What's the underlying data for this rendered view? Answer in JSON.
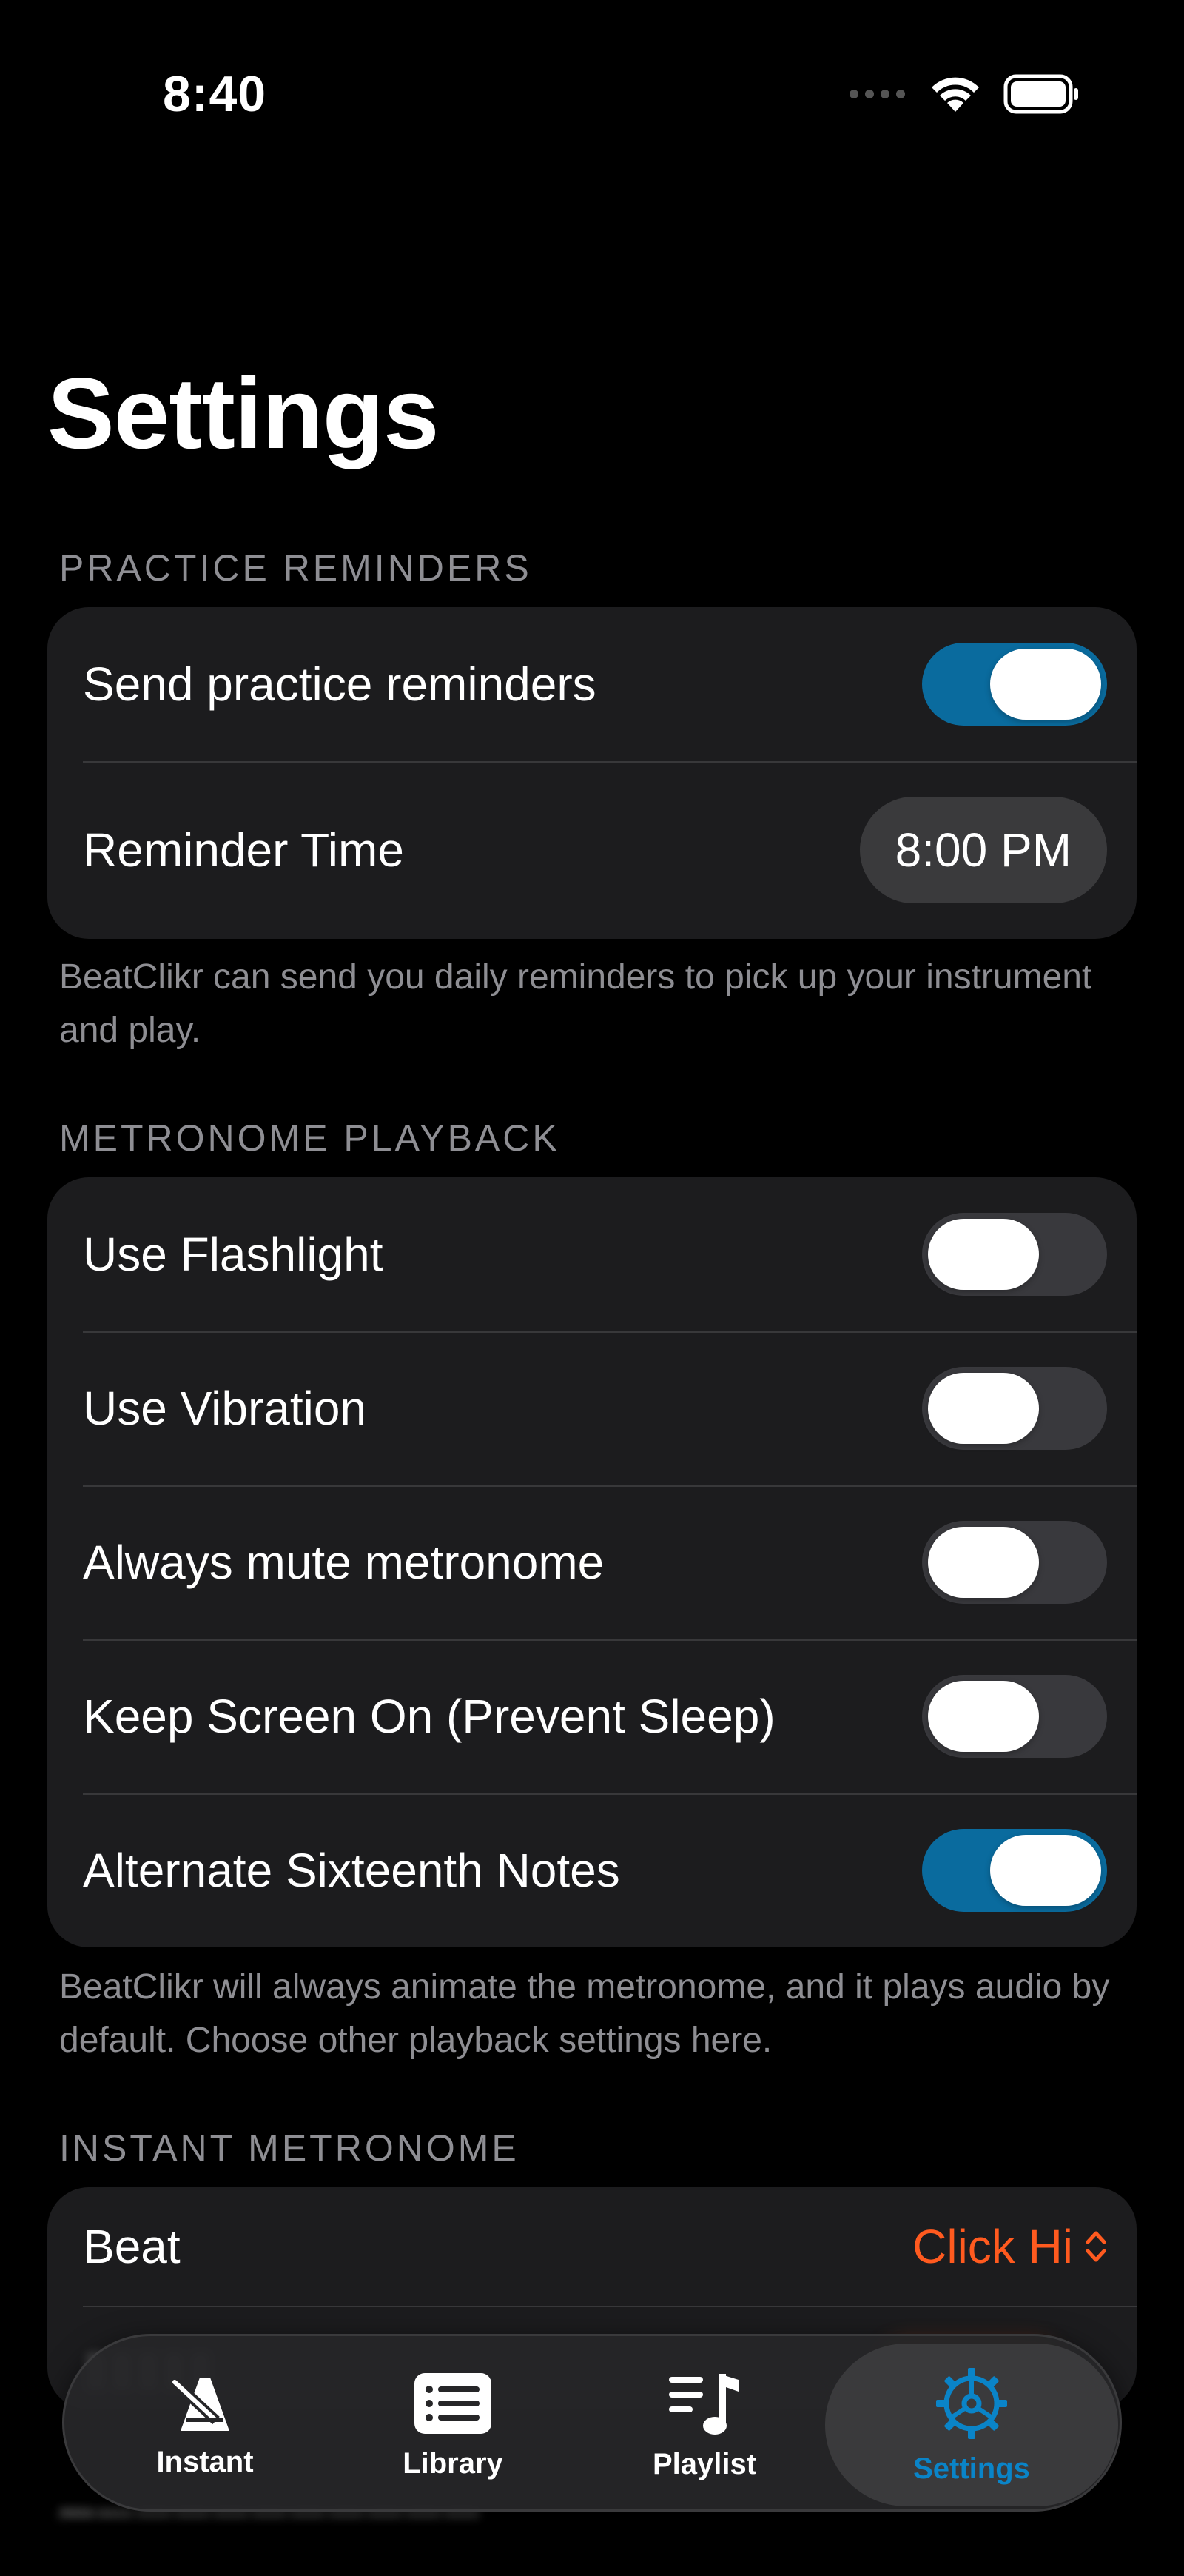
{
  "status_bar": {
    "time": "8:40"
  },
  "page_title": "Settings",
  "sections": {
    "reminders": {
      "header": "PRACTICE REMINDERS",
      "send_label": "Send practice reminders",
      "send_on": true,
      "time_label": "Reminder Time",
      "time_value": "8:00 PM",
      "footer": "BeatClikr can send you daily reminders to pick up your instrument and play."
    },
    "playback": {
      "header": "METRONOME PLAYBACK",
      "rows": [
        {
          "label": "Use Flashlight",
          "on": false
        },
        {
          "label": "Use Vibration",
          "on": false
        },
        {
          "label": "Always mute metronome",
          "on": false
        },
        {
          "label": "Keep Screen On (Prevent Sleep)",
          "on": false
        },
        {
          "label": "Alternate Sixteenth Notes",
          "on": true
        }
      ],
      "footer": "BeatClikr will always animate the metronome, and it plays audio by default. Choose other playback settings here."
    },
    "instant": {
      "header": "INSTANT METRONOME",
      "beat_label": "Beat",
      "beat_value": "Click Hi"
    }
  },
  "tab_bar": {
    "tabs": [
      {
        "label": "Instant",
        "icon": "metronome-icon"
      },
      {
        "label": "Library",
        "icon": "list-icon"
      },
      {
        "label": "Playlist",
        "icon": "music-list-icon"
      },
      {
        "label": "Settings",
        "icon": "gear-icon",
        "selected": true
      }
    ]
  },
  "colors": {
    "accent_blue": "#0a6b9e",
    "accent_orange": "#ff5a1f",
    "group_bg": "#1c1c1e"
  }
}
